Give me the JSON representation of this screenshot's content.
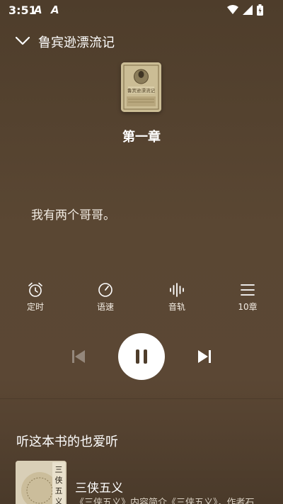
{
  "status_bar": {
    "time": "3:51",
    "notification_icons": [
      "A",
      "A"
    ],
    "system_icons": [
      "wifi-icon",
      "signal-icon",
      "battery-icon"
    ]
  },
  "header": {
    "book_title": "鲁宾逊漂流记",
    "cover_text": "鲁宾逊漂流记"
  },
  "now_playing": {
    "chapter": "第一章",
    "lyric": "我有两个哥哥。"
  },
  "controls": {
    "timer_label": "定时",
    "speed_label": "语速",
    "voice_label": "音轨",
    "chapters_label": "10章"
  },
  "player": {
    "state": "playing"
  },
  "recommend": {
    "section_title": "听这本书的也爱听",
    "items": [
      {
        "title": "三侠五义",
        "cover_text": "三侠五义",
        "description": "《三侠五义》内容简介《三侠五义》，作者石..."
      }
    ]
  },
  "colors": {
    "background": "#5a4733",
    "text": "#ffffff"
  }
}
